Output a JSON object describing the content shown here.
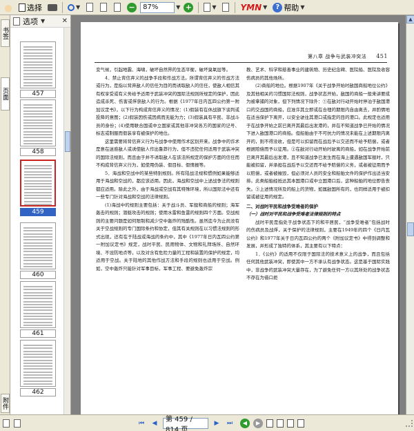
{
  "toolbar": {
    "select_label": "选择",
    "zoom_value": "87%",
    "logo_text": "YMN",
    "help_label": "帮助"
  },
  "left_tabs": [
    "书签",
    "页面",
    "附件"
  ],
  "thumbnails": {
    "options_label": "选项",
    "pages": [
      {
        "label": "457",
        "selected": false
      },
      {
        "label": "458",
        "selected": false
      },
      {
        "label": "459",
        "selected": true
      },
      {
        "label": "460",
        "selected": false
      },
      {
        "label": "461",
        "selected": false
      },
      {
        "label": "462",
        "selected": false
      }
    ]
  },
  "document": {
    "header_title": "第八章 战争与武装冲突法",
    "page_number": "451",
    "left_column": [
      {
        "type": "p",
        "text": "变气候，引起地震、海啸，破坏自然界的生态平衡，破坏臭氧层等。",
        "indent": false
      },
      {
        "type": "p",
        "text": "4．禁止背信弃义的战争手段和作战方法。所谓背信弃义的作战方法或行为，是指以背弃敌人的信任为目的而诱取敌人的信任，使敌人相信其有权享受或有义务给予适用于武装冲突的国际法规则所规定的保护，因此造成杀死、伤害或俘获敌人的行为。根据《1977年日内瓦四公约第一附加议定书》，以下行为构成背信弃义的情况：(1)假装有在休战旗下谈判或投降的意图；(2)假装因伤或因病而无能为力；(3)假装具有平民、非战斗员的身份；(4)使用联合国或中立国家或其他非冲突各方的国家的记号、标志或制服而假装享有被保护的地位。"
      },
      {
        "type": "p",
        "text": "这里需要将背信弃义行为与战争中使用作术区别开来。战争中的诈术是意在迷惑敌人或诱使敌人作出鲁莽行为，但不违犯任何适用于武装冲突的国际法规则，而且由于并不诱取敌人在该法所规定的保护方面的信任而不构成背信弃义行为，如使用伪装、假目标、假情报等。"
      },
      {
        "type": "p",
        "text": "5．海战和空战中的某些特别规则。所有陆战法规和惯例如果能够适用于海战和空战的，都应该适用。因此，海战和空战中上述战争法的规则都应适用。除此之外，由于海战或空战有其特殊环境，所以国际法中还有一些专门针对海战和空战的法律规则。"
      },
      {
        "type": "p",
        "text": "(1)海战中的规则主要包括：关于战斗员、军舰和商船的规则；海军轰击的规则；潜艇攻击的规则；使用水雷和鱼雷的规则四个方面。空战规则的主要问题是如何限制和减少空中轰炸的残酷性。虽然迄今为止尚没有关于空战规则的专门国际条约和协定，但其有关规则在以习惯法规则的形式出现，还有在于陆战或海战的条约中，其中《1977年日内瓦四公约第一附加议定书》规定，战时平民、民用物体、文物和礼拜场所、自然环境、不设防地点等，以及对含有危险力量的工程和装置的保护的规定，均适用于空战。关于陆地的其他作战方法和手段的规则也适用于空战。例如，空中轰炸只能针对军事目标，军事工程、要避免轰炸宗"
      }
    ],
    "right_column": [
      {
        "type": "p",
        "text": "教、艺术、科学和慈善事业的建筑物、历史纪念碑、医院船、医院及收容伤病员的其他场所。",
        "indent": false
      },
      {
        "type": "p",
        "text": "(2)商船的地位。根据1907年《关于战争开始时敌国商船地位公约》及其他相关的习惯国际法规则，战争状态开始，敌国的商船一般来讲要成为被拿捕的对象，但下列情况下除外：①在敌对行动开始时停泊于敌国港口的交战国的商船，应准许其立即或在合理的期限内自由离去，并酌情地在适当保护下离开，以安全驶往其港口或指定的目的港口。此规定也适用于在战争开始之前已离开其最后出发港的，并在不知道战争已开始的情况下进入敌国港口的商船。但船舶由于不可抗力的情况未能在上述期限内离开的，则不得没收，但是可以扣留而在战后予以交还而不给予赔偿，或者根据赔偿而予以征用。②在敌对行动开始时驶离的商船，如在战争开始前已离开其最后出发港，且不知道战争已发生而在海上遭遇敌国军舰时，只能被扣留，并承担在战后予以交还而不给予赔偿的义务，或者被征用而予以赔偿，或者被摧毁，但必须对人员的安全和船舶文件的保护作出适当安排。此类船舶经抵达其本国港口或中立国港口后，这种船舶的地位即告丧失。③上述情况所及的船上的货物，如属敌国所有的，也同样适用于被扣留或被征用的规定。"
      },
      {
        "type": "sec",
        "text": "二、对战时平民和战争受难者的保护"
      },
      {
        "type": "sub",
        "text": "（一）战时对平民和战争受难者法律规则的特点"
      },
      {
        "type": "p",
        "text": "战时平民是指处于战争状态下的和平居民，“战争受难者”包括战时的伤病员及战俘，关于保护的法律规则，主要在1949年的四个《日内瓦公约》和1977年关于日内瓦四公约的两个《附加议定书》中得到调整和发展，并形成了独特的体系，其主要有以下特点："
      },
      {
        "type": "p",
        "text": "1．《公约》的适用不仅限于国际法的技术意义上的战争，而且包括任何其他武装冲突，即使其中一方不承认有战争状态。这是基于国际实践中，非战争的武装冲突大量存在，为了避免任何一方以其所处的战争状态不存在为借口拒"
      }
    ]
  },
  "statusbar": {
    "page_field": "第 459 / 814 页"
  }
}
